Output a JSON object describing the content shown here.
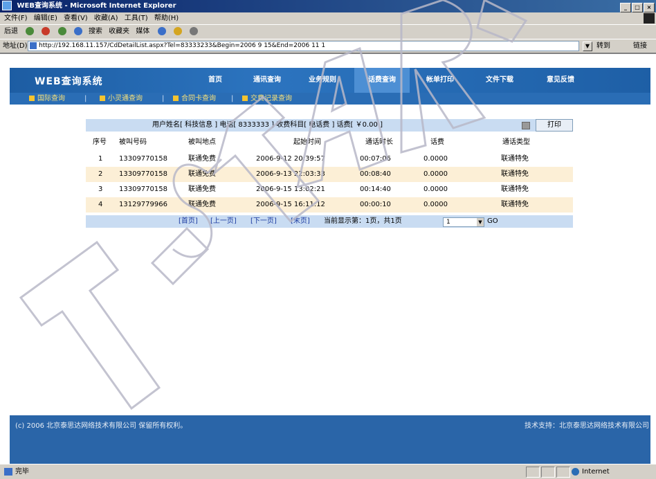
{
  "window": {
    "title": "WEB查询系统 - Microsoft Internet Explorer"
  },
  "menu": [
    "文件(F)",
    "编辑(E)",
    "查看(V)",
    "收藏(A)",
    "工具(T)",
    "帮助(H)"
  ],
  "toolbar": {
    "back": "后退",
    "favorites": "收藏夹",
    "media": "媒体",
    "search": "搜索"
  },
  "address": {
    "label": "地址(D)",
    "url": "http://192.168.11.157/CdDetailList.aspx?Tel=83333233&Begin=2006 9 15&End=2006 11 1",
    "go": "转到",
    "links": "链接"
  },
  "app": {
    "title": "WEB查询系统",
    "nav": [
      "首页",
      "通讯查询",
      "业务规则",
      "话费查询",
      "帐单打印",
      "文件下载",
      "意见反馈"
    ],
    "active_nav": "话费查询",
    "subnav": [
      "国际查询",
      "小灵通查询",
      "合同卡查询",
      "交费记录查询"
    ]
  },
  "info": {
    "text": "用户姓名[ 科技信息 ] 电话[ 8333333 ] 收费科目[ 电话费 ] 话费[ ￥0.00 ]",
    "print": "打印"
  },
  "table": {
    "headers": [
      "序号",
      "被叫号码",
      "被叫地点",
      "起始时间",
      "通话时长",
      "话费",
      "通话类型"
    ],
    "rows": [
      [
        "1",
        "13309770158",
        "联通免费",
        "2006-9-12 20:39:57",
        "00:07:06",
        "0.0000",
        "联通特免"
      ],
      [
        "2",
        "13309770158",
        "联通免费",
        "2006-9-13 22:03:33",
        "00:08:40",
        "0.0000",
        "联通特免"
      ],
      [
        "3",
        "13309770158",
        "联通免费",
        "2006-9-15 13:02:21",
        "00:14:40",
        "0.0000",
        "联通特免"
      ],
      [
        "4",
        "13129779966",
        "联通免费",
        "2006-9-15 16:11:12",
        "00:00:10",
        "0.0000",
        "联通特免"
      ]
    ]
  },
  "pager": {
    "first": "[首页]",
    "prev": "[上一页]",
    "next": "[下一页]",
    "last": "[末页]",
    "status": "当前显示第：1页，共1页",
    "page_value": "1",
    "go": "GO"
  },
  "footer": {
    "copyright": "(c) 2006 北京泰思达网络技术有限公司 保留所有权利。",
    "support": "技术支持：北京泰思达网络技术有限公司"
  },
  "status": {
    "done": "完毕",
    "zone": "Internet"
  },
  "watermark": {
    "text": "T-STAR",
    "color": "#d8d8e8"
  }
}
